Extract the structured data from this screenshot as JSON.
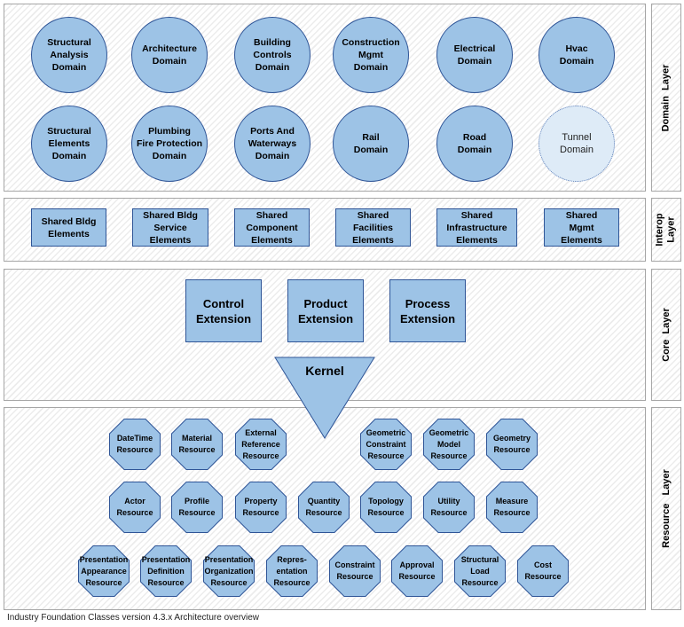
{
  "caption": "Industry Foundation Classes version 4.3.x  Architecture overview",
  "colors": {
    "node_fill": "#9dc3e6",
    "node_border": "#2f5597",
    "future_fill": "#deebf7",
    "panel_border": "#a6a6a6"
  },
  "layers": {
    "domain": {
      "label": "Domain  Layer",
      "nodes": [
        {
          "label": "Structural\nAnalysis\nDomain",
          "shape": "circle"
        },
        {
          "label": "Architecture\nDomain",
          "shape": "circle"
        },
        {
          "label": "Building\nControls\nDomain",
          "shape": "circle"
        },
        {
          "label": "Construction\nMgmt\nDomain",
          "shape": "circle"
        },
        {
          "label": "Electrical\nDomain",
          "shape": "circle"
        },
        {
          "label": "Hvac\nDomain",
          "shape": "circle"
        },
        {
          "label": "Structural\nElements\nDomain",
          "shape": "circle"
        },
        {
          "label": "Plumbing\nFire Protection\nDomain",
          "shape": "circle"
        },
        {
          "label": "Ports  And\nWaterways\nDomain",
          "shape": "circle"
        },
        {
          "label": "Rail\nDomain",
          "shape": "circle"
        },
        {
          "label": "Road\nDomain",
          "shape": "circle"
        },
        {
          "label": "Tunnel\nDomain",
          "shape": "circle",
          "style": "dotted-light"
        }
      ]
    },
    "interop": {
      "label": "Interop\nLayer",
      "nodes": [
        {
          "label": "Shared Bldg\nElements"
        },
        {
          "label": "Shared Bldg\nService\nElements"
        },
        {
          "label": "Shared\nComponent\nElements"
        },
        {
          "label": "Shared\nFacilities\nElements"
        },
        {
          "label": "Shared\nInfrastructure\nElements"
        },
        {
          "label": "Shared\nMgmt\nElements"
        }
      ]
    },
    "core": {
      "label": "Core  Layer",
      "nodes": [
        {
          "label": "Control\nExtension"
        },
        {
          "label": "Product\nExtension"
        },
        {
          "label": "Process\nExtension"
        }
      ],
      "kernel": "Kernel"
    },
    "resource": {
      "label": "Resource   Layer",
      "nodes": [
        {
          "label": "DateTime\nResource"
        },
        {
          "label": "Material\nResource"
        },
        {
          "label": "External\nReference\nResource"
        },
        {
          "label": "Geometric\nConstraint\nResource"
        },
        {
          "label": "Geometric\nModel\nResource"
        },
        {
          "label": "Geometry\nResource"
        },
        {
          "label": "Actor\nResource"
        },
        {
          "label": "Profile\nResource"
        },
        {
          "label": "Property\nResource"
        },
        {
          "label": "Quantity\nResource"
        },
        {
          "label": "Topology\nResource"
        },
        {
          "label": "Utility\nResource"
        },
        {
          "label": "Measure\nResource"
        },
        {
          "label": "Presentation\nAppearance\nResource"
        },
        {
          "label": "Presentation\nDefinition\nResource"
        },
        {
          "label": "Presentation\nOrganization\nResource"
        },
        {
          "label": "Repres-\nentation\nResource"
        },
        {
          "label": "Constraint\nResource"
        },
        {
          "label": "Approval\nResource"
        },
        {
          "label": "Structural\nLoad\nResource"
        },
        {
          "label": "Cost\nResource"
        }
      ]
    }
  }
}
